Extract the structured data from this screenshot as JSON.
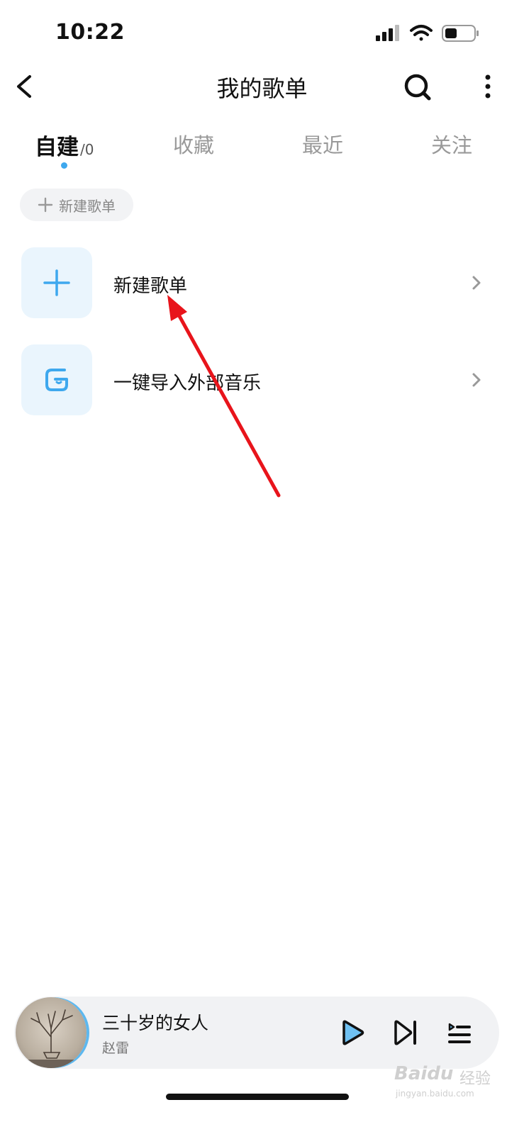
{
  "status_bar": {
    "time": "10:22",
    "icons": [
      "signal-icon",
      "wifi-icon",
      "battery-icon"
    ]
  },
  "header": {
    "title": "我的歌单",
    "back_icon": "chevron-left-icon",
    "search_icon": "search-icon",
    "more_icon": "more-vertical-icon"
  },
  "tabs": [
    {
      "label": "自建",
      "count": "/0",
      "active": true
    },
    {
      "label": "收藏"
    },
    {
      "label": "最近"
    },
    {
      "label": "关注"
    }
  ],
  "chip": {
    "label": "新建歌单",
    "icon": "plus-icon"
  },
  "rows": [
    {
      "label": "新建歌单",
      "icon": "plus-icon"
    },
    {
      "label": "一键导入外部音乐",
      "icon": "import-icon"
    }
  ],
  "player": {
    "title": "三十岁的女人",
    "artist": "赵雷",
    "controls": [
      "play-icon",
      "next-icon",
      "playlist-icon"
    ]
  },
  "watermark": {
    "brand": "Baidu",
    "cn": "经验",
    "url": "jingyan.baidu.com"
  },
  "colors": {
    "accent": "#3ea8ee",
    "icon_tile_bg": "#eaf5fd",
    "annotation_arrow": "#e8141b",
    "player_bg": "#f1f2f4"
  }
}
